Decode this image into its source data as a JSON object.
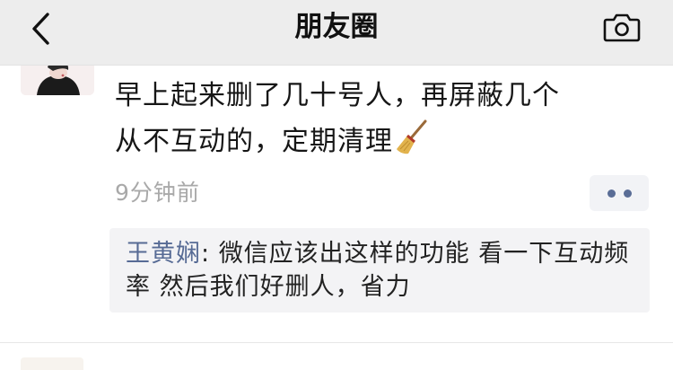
{
  "navbar": {
    "title": "朋友圈",
    "back_icon": "chevron-left-icon",
    "camera_icon": "camera-icon"
  },
  "post": {
    "text_line1": "早上起来删了几十号人，再屏蔽几个",
    "text_line2": "从不互动的，定期清理",
    "emoji": "broom-icon",
    "timestamp": "9分钟前",
    "more_icon": "more-dots-icon"
  },
  "comment": {
    "author": "王黄娴",
    "separator": ": ",
    "text": "微信应该出这样的功能 看一下互动频率 然后我们好删人，省力"
  },
  "colors": {
    "navbar_bg": "#ededed",
    "link_blue": "#576b95",
    "timestamp_gray": "#a9a9a9",
    "comment_bg": "#f3f3f5"
  }
}
